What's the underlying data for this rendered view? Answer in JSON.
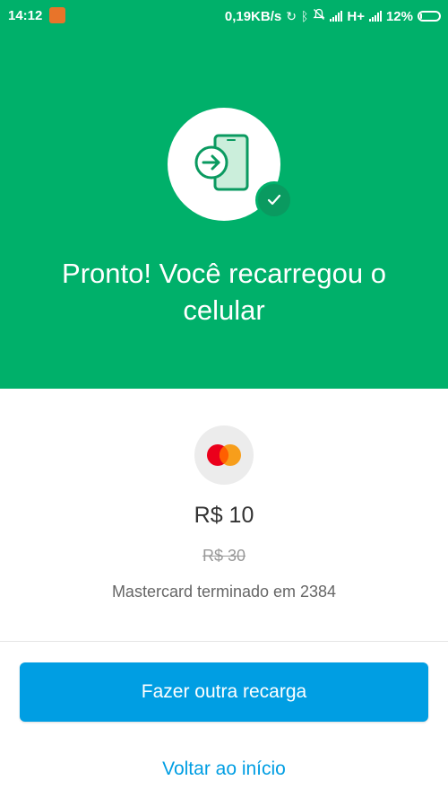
{
  "status_bar": {
    "time": "14:12",
    "network_speed": "0,19KB/s",
    "network_type": "H+",
    "battery_percent": "12%",
    "battery_level": 0.12
  },
  "success": {
    "title": "Pronto! Você recarregou o celular"
  },
  "payment": {
    "amount": "R$ 10",
    "original_amount": "R$ 30",
    "card_description": "Mastercard terminado em 2384"
  },
  "actions": {
    "primary_label": "Fazer outra recarga",
    "secondary_label": "Voltar ao início"
  },
  "colors": {
    "brand_green": "#00b06a",
    "accent_blue": "#009ee3"
  },
  "icons": {
    "hero": "phone-recharge-icon",
    "badge": "checkmark-icon",
    "card": "mastercard-logo-icon"
  }
}
